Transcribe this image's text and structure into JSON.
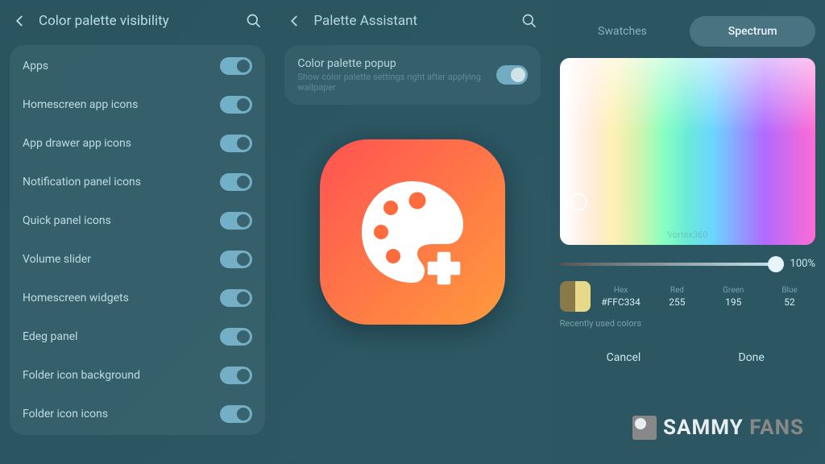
{
  "panel1": {
    "title": "Color palette visibility",
    "items": [
      "Apps",
      "Homescreen app icons",
      "App drawer app icons",
      "Notification panel icons",
      "Quick panel icons",
      "Volume slider",
      "Homescreen widgets",
      "Edeg panel",
      "Folder icon background",
      "Folder icon icons"
    ]
  },
  "panel2": {
    "title": "Palette Assistant",
    "popup_label": "Color palette popup",
    "popup_sub": "Show color palette settings right after applying wallpaper"
  },
  "panel3": {
    "tabs": {
      "swatches": "Swatches",
      "spectrum": "Spectrum"
    },
    "slider_pct": "100%",
    "hex_label": "Hex",
    "hex": "#FFC334",
    "red_label": "Red",
    "red": "255",
    "green_label": "Green",
    "green": "195",
    "blue_label": "Blue",
    "blue": "52",
    "recent_label": "Recently used colors",
    "cancel": "Cancel",
    "done": "Done",
    "swatch_colors": [
      "#8a7a4a",
      "#e8d98a"
    ]
  },
  "watermark": {
    "text1": "SAMMY",
    "text2": "FANS"
  }
}
